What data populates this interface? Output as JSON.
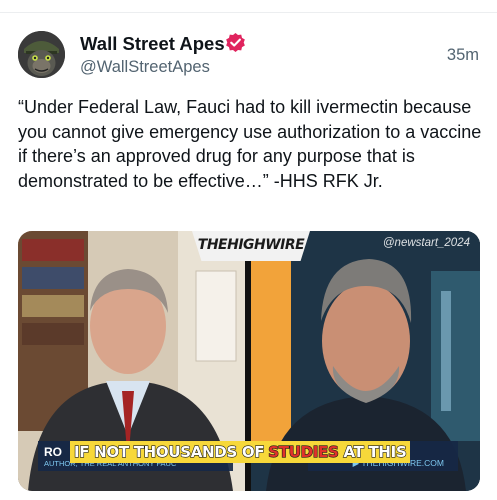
{
  "post": {
    "author_name": "Wall Street Apes",
    "author_handle": "@WallStreetApes",
    "timestamp": "35m",
    "verified": true,
    "text": "“Under Federal Law, Fauci had to kill ivermectin because you cannot give emergency use authorization to a vaccine if there’s an approved drug for any purpose that is demonstrated to be effective…” -HHS RFK Jr."
  },
  "media": {
    "logo_text": "THEHIGHWIRE",
    "watermark": "@newstart_2024",
    "lower_third_left_name": "RO",
    "lower_third_left_subtitle": "AUTHOR, THE REAL ANTHONY FAUC",
    "lower_third_right_url": "▶ THEHIGHWIRE.COM",
    "caption": {
      "part1": "IF NOT THOUSANDS OF",
      "part2": "STUDIES",
      "part3": "AT THIS"
    }
  },
  "colors": {
    "verified_badge": "#e0245e",
    "caption_bg": "#f7d83a",
    "caption_highlight": "#e0322b",
    "handle_gray": "#536471"
  },
  "icons": {
    "avatar": "ape-soldier-avatar",
    "verified": "verified-badge-icon"
  }
}
